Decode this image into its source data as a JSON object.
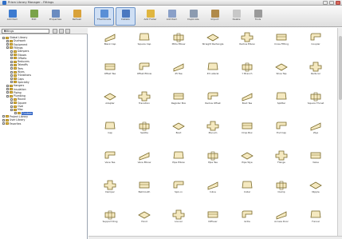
{
  "window": {
    "title": "Prism Library Manager - Fittings"
  },
  "toolbar": {
    "buttons": [
      {
        "label": "Add Item",
        "icon": "add-item-icon",
        "color": "#3d7bd0",
        "active": false
      },
      {
        "label": "Edit",
        "icon": "edit-icon",
        "color": "#7aa34a",
        "active": false
      },
      {
        "label": "Properties",
        "icon": "properties-icon",
        "color": "#6b8cc0",
        "active": false
      },
      {
        "label": "Refresh",
        "icon": "refresh-icon",
        "color": "#d9a23a",
        "active": false
      },
      {
        "label": "Thumbnails",
        "icon": "thumbnails-icon",
        "color": "#5a8fd6",
        "active": true
      },
      {
        "label": "Details",
        "icon": "details-icon",
        "color": "#4a78c0",
        "active": true
      },
      {
        "label": "Add Folder",
        "icon": "add-folder-icon",
        "color": "#e0b640",
        "active": false
      },
      {
        "label": "Add Item",
        "icon": "add-item-icon",
        "color": "#8aa0c8",
        "active": false
      },
      {
        "label": "Duplicate",
        "icon": "duplicate-icon",
        "color": "#8c9bb0",
        "active": false
      },
      {
        "label": "Import",
        "icon": "import-icon",
        "color": "#b08a4a",
        "active": false
      },
      {
        "label": "Delete",
        "icon": "delete-icon",
        "color": "#c8c8c8",
        "active": false
      },
      {
        "label": "Tools",
        "icon": "tools-icon",
        "color": "#9a9a9a",
        "active": false
      }
    ]
  },
  "sidebar": {
    "dropdown": "Fittings",
    "tree": [
      {
        "label": "Global Library",
        "depth": 0
      },
      {
        "label": "Ductwork",
        "depth": 1
      },
      {
        "label": "Equipment",
        "depth": 1
      },
      {
        "label": "Fittings",
        "depth": 1
      },
      {
        "label": "Dampers",
        "depth": 2
      },
      {
        "label": "Elbows",
        "depth": 2
      },
      {
        "label": "Offsets",
        "depth": 2
      },
      {
        "label": "Reducers",
        "depth": 2
      },
      {
        "label": "Takeoffs",
        "depth": 2
      },
      {
        "label": "Tees",
        "depth": 2
      },
      {
        "label": "Wyes",
        "depth": 2
      },
      {
        "label": "Transitions",
        "depth": 2
      },
      {
        "label": "Caps",
        "depth": 2
      },
      {
        "label": "Specialty",
        "depth": 2
      },
      {
        "label": "Hangers",
        "depth": 1
      },
      {
        "label": "Insulation",
        "depth": 1
      },
      {
        "label": "Piping",
        "depth": 1
      },
      {
        "label": "Plumbing",
        "depth": 1
      },
      {
        "label": "Round",
        "depth": 2
      },
      {
        "label": "Square",
        "depth": 2
      },
      {
        "label": "Oval",
        "depth": 2
      },
      {
        "label": "Misc",
        "depth": 2
      },
      {
        "label": "Custom",
        "depth": 3
      },
      {
        "label": "Project Library",
        "depth": 0
      },
      {
        "label": "User Library",
        "depth": 0
      },
      {
        "label": "Favorites",
        "depth": 0
      }
    ],
    "selected_index": 22
  },
  "items": [
    {
      "caption": "Blank Cap"
    },
    {
      "caption": "Square Cap"
    },
    {
      "caption": "Mitre Elbow"
    },
    {
      "caption": "Straight Rectangle"
    },
    {
      "caption": "Radius Elbow"
    },
    {
      "caption": "Cross Fitting"
    },
    {
      "caption": "Coupler"
    },
    {
      "caption": "Offset Tee"
    },
    {
      "caption": "Offset Elbow"
    },
    {
      "caption": "45 Tee"
    },
    {
      "caption": "45 Lateral"
    },
    {
      "caption": "Y Branch"
    },
    {
      "caption": "Shoe Tap"
    },
    {
      "caption": "Reducer"
    },
    {
      "caption": "Adapter"
    },
    {
      "caption": "Transition"
    },
    {
      "caption": "Register Box"
    },
    {
      "caption": "Radius Offset"
    },
    {
      "caption": "Boot Tee"
    },
    {
      "caption": "Splitter"
    },
    {
      "caption": "Square Throat"
    },
    {
      "caption": "Cap"
    },
    {
      "caption": "Saddle"
    },
    {
      "caption": "Boot"
    },
    {
      "caption": "Plenum"
    },
    {
      "caption": "Drop Box"
    },
    {
      "caption": "End Cap"
    },
    {
      "caption": "Wye"
    },
    {
      "caption": "Vane Tee"
    },
    {
      "caption": "Vane Elbow"
    },
    {
      "caption": "Pipe Elbow"
    },
    {
      "caption": "Pipe Tee"
    },
    {
      "caption": "Pipe Wye"
    },
    {
      "caption": "Flange"
    },
    {
      "caption": "Valve"
    },
    {
      "caption": "Damper"
    },
    {
      "caption": "Bellmouth"
    },
    {
      "caption": "Spin-in"
    },
    {
      "caption": "Inline"
    },
    {
      "caption": "Collar"
    },
    {
      "caption": "Clamp"
    },
    {
      "caption": "Nipple"
    },
    {
      "caption": "Support Ring"
    },
    {
      "caption": "Hood"
    },
    {
      "caption": "Louver"
    },
    {
      "caption": "Diffuser"
    },
    {
      "caption": "Grille"
    },
    {
      "caption": "Access Door"
    },
    {
      "caption": "Funnel"
    }
  ]
}
